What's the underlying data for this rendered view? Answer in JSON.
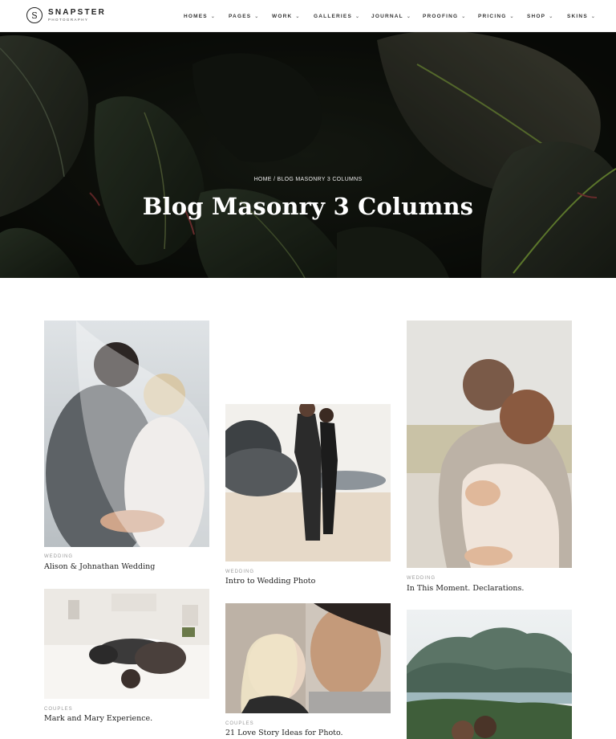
{
  "brand": {
    "name": "SNAPSTER",
    "tagline": "PHOTOGRAPHY",
    "mark": "S"
  },
  "nav": [
    {
      "label": "HOMES"
    },
    {
      "label": "PAGES"
    },
    {
      "label": "WORK"
    },
    {
      "label": "GALLERIES"
    },
    {
      "label": "JOURNAL"
    },
    {
      "label": "PROOFING"
    },
    {
      "label": "PRICING"
    },
    {
      "label": "SHOP"
    },
    {
      "label": "SKINS"
    }
  ],
  "hero": {
    "breadcrumb": "HOME / BLOG MASONRY 3 COLUMNS",
    "title": "Blog Masonry 3 Columns"
  },
  "posts": [
    {
      "category": "WEDDING",
      "title": "Alison & Johnathan Wedding"
    },
    {
      "category": "WEDDING",
      "title": "Intro to Wedding Photo"
    },
    {
      "category": "WEDDING",
      "title": "In This Moment. Declarations."
    },
    {
      "category": "COUPLES",
      "title": "Mark and Mary Experience."
    },
    {
      "category": "COUPLES",
      "title": "21 Love Story Ideas for Photo."
    }
  ],
  "colors": {
    "accent": "#222222",
    "meta": "#999999",
    "hero_bg": "#0e110c"
  }
}
